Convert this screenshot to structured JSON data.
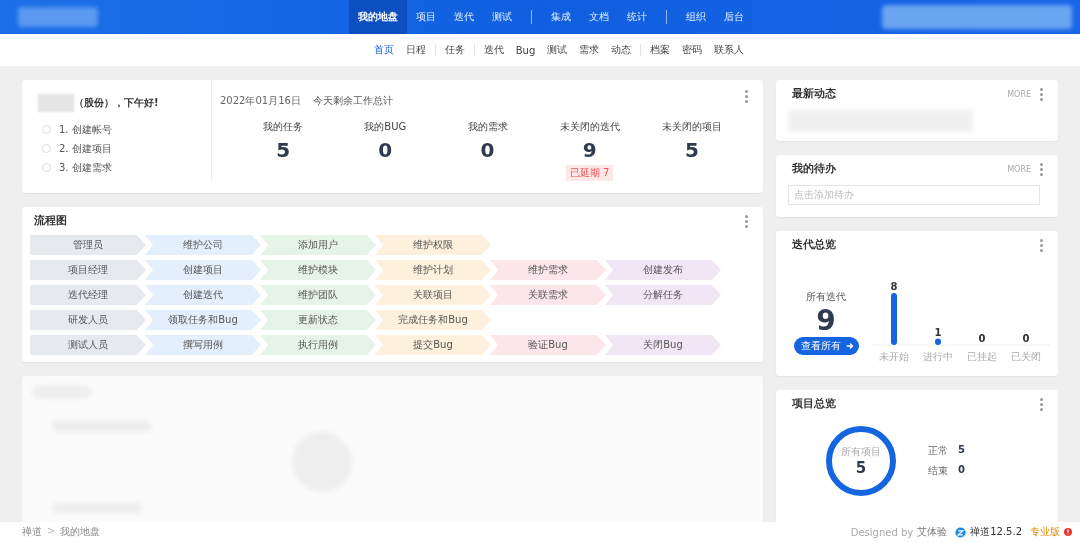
{
  "top_nav": {
    "groups": [
      [
        {
          "label": "我的地盘",
          "selected": true
        },
        {
          "label": "项目",
          "selected": false
        },
        {
          "label": "迭代",
          "selected": false
        },
        {
          "label": "测试",
          "selected": false
        }
      ],
      [
        {
          "label": "集成",
          "selected": false
        },
        {
          "label": "文档",
          "selected": false
        },
        {
          "label": "统计",
          "selected": false
        }
      ],
      [
        {
          "label": "组织",
          "selected": false
        },
        {
          "label": "后台",
          "selected": false
        }
      ]
    ]
  },
  "sub_nav": {
    "groups": [
      [
        {
          "label": "首页",
          "selected": true
        },
        {
          "label": "日程",
          "selected": false
        }
      ],
      [
        {
          "label": "任务",
          "selected": false
        }
      ],
      [
        {
          "label": "迭代",
          "selected": false
        },
        {
          "label": "Bug",
          "selected": false
        },
        {
          "label": "测试",
          "selected": false
        },
        {
          "label": "需求",
          "selected": false
        },
        {
          "label": "动态",
          "selected": false
        }
      ],
      [
        {
          "label": "档案",
          "selected": false
        },
        {
          "label": "密码",
          "selected": false
        },
        {
          "label": "联系人",
          "selected": false
        }
      ]
    ]
  },
  "welcome": {
    "greeting": "（股份），下午好!",
    "steps": [
      "1. 创建帐号",
      "2. 创建项目",
      "3. 创建需求"
    ],
    "date": "2022年01月16日",
    "summary_title": "今天剩余工作总计",
    "stats": [
      {
        "label": "我的任务",
        "value": "5"
      },
      {
        "label": "我的BUG",
        "value": "0"
      },
      {
        "label": "我的需求",
        "value": "0"
      },
      {
        "label": "未关闭的迭代",
        "value": "9",
        "badge": "已延期 7"
      },
      {
        "label": "未关闭的项目",
        "value": "5"
      }
    ]
  },
  "flow": {
    "title": "流程图",
    "rows": [
      {
        "role": "管理员",
        "steps": [
          {
            "label": "维护公司",
            "color": "#e3effc"
          },
          {
            "label": "添加用户",
            "color": "#e5f4e7"
          },
          {
            "label": "维护权限",
            "color": "#fdf0dd"
          }
        ]
      },
      {
        "role": "项目经理",
        "steps": [
          {
            "label": "创建项目",
            "color": "#e3effc"
          },
          {
            "label": "维护模块",
            "color": "#e5f4e7"
          },
          {
            "label": "维护计划",
            "color": "#fdf0dd"
          },
          {
            "label": "维护需求",
            "color": "#fce6ea"
          },
          {
            "label": "创建发布",
            "color": "#f1e6f6"
          }
        ]
      },
      {
        "role": "迭代经理",
        "steps": [
          {
            "label": "创建迭代",
            "color": "#e3effc"
          },
          {
            "label": "维护团队",
            "color": "#e5f4e7"
          },
          {
            "label": "关联项目",
            "color": "#fdf0dd"
          },
          {
            "label": "关联需求",
            "color": "#fce6ea"
          },
          {
            "label": "分解任务",
            "color": "#f1e6f6"
          }
        ]
      },
      {
        "role": "研发人员",
        "steps": [
          {
            "label": "领取任务和Bug",
            "color": "#e3effc"
          },
          {
            "label": "更新状态",
            "color": "#e5f4e7"
          },
          {
            "label": "完成任务和Bug",
            "color": "#fdf0dd"
          }
        ]
      },
      {
        "role": "测试人员",
        "steps": [
          {
            "label": "撰写用例",
            "color": "#e3effc"
          },
          {
            "label": "执行用例",
            "color": "#e5f4e7"
          },
          {
            "label": "提交Bug",
            "color": "#fdf0dd"
          },
          {
            "label": "验证Bug",
            "color": "#fce6ea"
          },
          {
            "label": "关闭Bug",
            "color": "#f1e6f6"
          }
        ]
      }
    ]
  },
  "recent": {
    "title": "最新动态",
    "more": "MORE"
  },
  "todo": {
    "title": "我的待办",
    "more": "MORE",
    "placeholder": "点击添加待办"
  },
  "iterations": {
    "title": "迭代总览",
    "total_label": "所有迭代",
    "total": "9",
    "button": "查看所有",
    "chart_data": {
      "type": "bar",
      "categories": [
        "未开始",
        "进行中",
        "已挂起",
        "已关闭"
      ],
      "values": [
        8,
        1,
        0,
        0
      ],
      "data_labels": true
    }
  },
  "projects": {
    "title": "项目总览",
    "ring_label": "所有项目",
    "total": "5",
    "legend": [
      {
        "label": "正常",
        "value": "5"
      },
      {
        "label": "结束",
        "value": "0"
      }
    ]
  },
  "footer": {
    "breadcrumb": [
      "禅道",
      "我的地盘"
    ],
    "separator": ">",
    "designed_by": "Designed by",
    "designer": "艾体验",
    "version": "禅道12.5.2",
    "edition": "专业版"
  }
}
